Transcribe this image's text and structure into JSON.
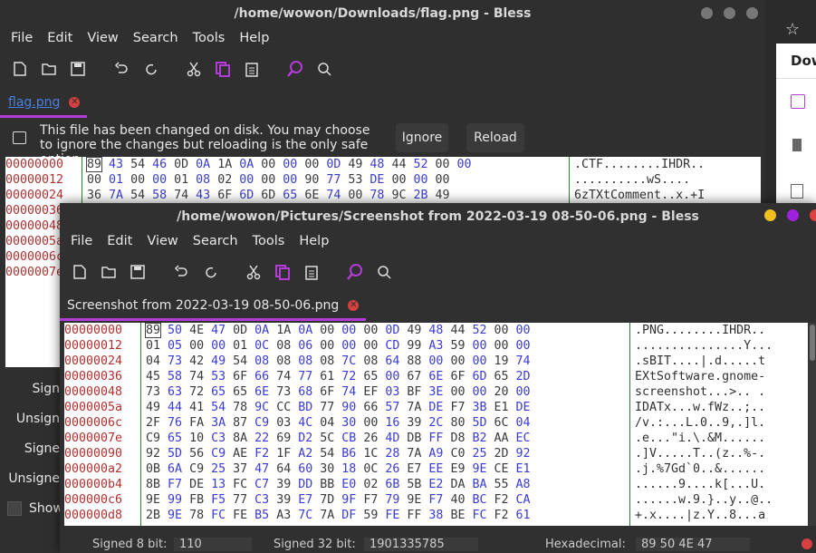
{
  "bg_window": {
    "title": "/home/wowon/Downloads/flag.png - Bless",
    "menu": [
      "File",
      "Edit",
      "View",
      "Search",
      "Tools",
      "Help"
    ],
    "tab_label": "flag.png",
    "notice": "This file has been changed on disk. You may choose to ignore the changes but reloading is the only safe option.",
    "ignore_label": "Ignore",
    "reload_label": "Reload",
    "offsets": [
      "00000000",
      "00000012",
      "00000024",
      "00000036",
      "00000048",
      "0000005a",
      "0000006c",
      "0000007e"
    ],
    "hex_rows": [
      "89 43 54 46 0D 0A 1A 0A 00 00 00 0D 49 48 44 52 00 00",
      "00 01 00 00 01 08 02 00 00 00 90 77 53 DE 00 00 00",
      "36 7A 54 58 74 43 6F 6D 6D 65 6E 74 00 78 9C 2B 49"
    ],
    "ascii_rows": [
      ".CTF........IHDR..",
      "..........wS....",
      "6zTXtComment..x.+I"
    ],
    "side_labels": [
      "Sign",
      "Unsign",
      "Signe",
      "Unsigne",
      "Show"
    ]
  },
  "fg_window": {
    "title": "/home/wowon/Pictures/Screenshot from 2022-03-19 08-50-06.png - Bless",
    "menu": [
      "File",
      "Edit",
      "View",
      "Search",
      "Tools",
      "Help"
    ],
    "tab_label": "Screenshot from 2022-03-19 08-50-06.png",
    "offsets": [
      "00000000",
      "00000012",
      "00000024",
      "00000036",
      "00000048",
      "0000005a",
      "0000006c",
      "0000007e",
      "00000090",
      "000000a2",
      "000000b4",
      "000000c6",
      "000000d8"
    ],
    "hex_rows": [
      "89 50 4E 47 0D 0A 1A 0A 00 00 00 0D 49 48 44 52 00 00",
      "01 05 00 00 01 0C 08 06 00 00 00 CD 99 A3 59 00 00 00",
      "04 73 42 49 54 08 08 08 08 7C 08 64 88 00 00 00 19 74",
      "45 58 74 53 6F 66 74 77 61 72 65 00 67 6E 6F 6D 65 2D",
      "73 63 72 65 65 6E 73 68 6F 74 EF 03 BF 3E 00 00 20 00",
      "49 44 41 54 78 9C CC BD 77 90 66 57 7A DE F7 3B E1 DE",
      "2F 76 FA 3A 87 C9 03 4C 04 30 00 16 39 2C 80 5D 6C 04",
      "C9 65 10 C3 8A 22 69 D2 5C CB 26 4D DB FF D8 B2 AA EC",
      "92 5D 56 C9 AE F2 1F A2 54 B6 1C 28 7A A9 C0 25 2D 92",
      "0B 6A C9 25 37 47 64 60 30 18 0C 26 E7 EE E9 9E CE E1",
      "8B F7 DE 13 FC C7 39 DD BB E0 02 6B 5B E2 DA BA 55 A8",
      "9E 99 FB F5 77 C3 39 E7 7D 9F F7 79 9E F7 40 BC F2 CA",
      "2B 9E 78 FC FE B5 A3 7C 7A DF 59 FE FF 38 BE FC F2 61"
    ],
    "ascii_rows": [
      ".PNG........IHDR..",
      "...............Y...",
      ".sBIT....|.d.....t",
      "EXtSoftware.gnome-",
      "screenshot...>.. .",
      "IDATx...w.fWz..;..",
      "/v.:...L.0..9,.]l.",
      ".e...\"i.\\.&M......",
      ".]V.....T..(z..%-.",
      ".j.%7Gd`0..&......",
      "......9....k[...U.",
      "......w.9.}..y..@..",
      "+.x....|z.Y..8...a"
    ],
    "status_labels": [
      "Signed 8 bit:",
      "110",
      "Signed 32 bit:",
      "1901335785",
      "Hexadecimal:",
      "89 50 4E 47"
    ]
  },
  "side_panel": {
    "title": "Dow",
    "accent": "#b33bd6"
  },
  "colors": {
    "accent": "#b33bd6",
    "offset": "#b03030",
    "hex_blue": "#3b3bd0",
    "btn_yellow": "#f0c020",
    "btn_purple": "#a020e0",
    "btn_red": "#e04040"
  }
}
